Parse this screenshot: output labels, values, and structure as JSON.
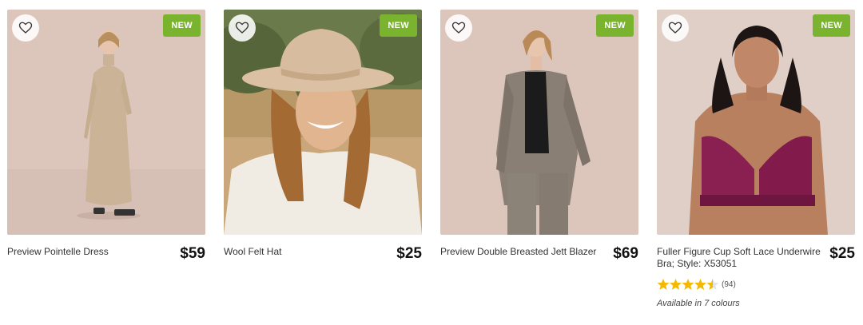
{
  "products": [
    {
      "name": "Preview Pointelle Dress",
      "price": "$59",
      "badge": "NEW",
      "wishlist_icon": "heart-outline-icon"
    },
    {
      "name": "Wool Felt Hat",
      "price": "$25",
      "badge": "NEW",
      "wishlist_icon": "heart-outline-icon"
    },
    {
      "name": "Preview Double Breasted Jett Blazer",
      "price": "$69",
      "badge": "NEW",
      "wishlist_icon": "heart-outline-icon"
    },
    {
      "name": "Fuller Figure Cup Soft Lace Underwire Bra; Style: X53051",
      "price": "$25",
      "badge": "NEW",
      "wishlist_icon": "heart-outline-icon",
      "rating": 4.5,
      "review_count": "(94)",
      "availability": "Available in 7 colours"
    }
  ],
  "colors": {
    "badge": "#7ab32e",
    "star": "#f5b800"
  }
}
